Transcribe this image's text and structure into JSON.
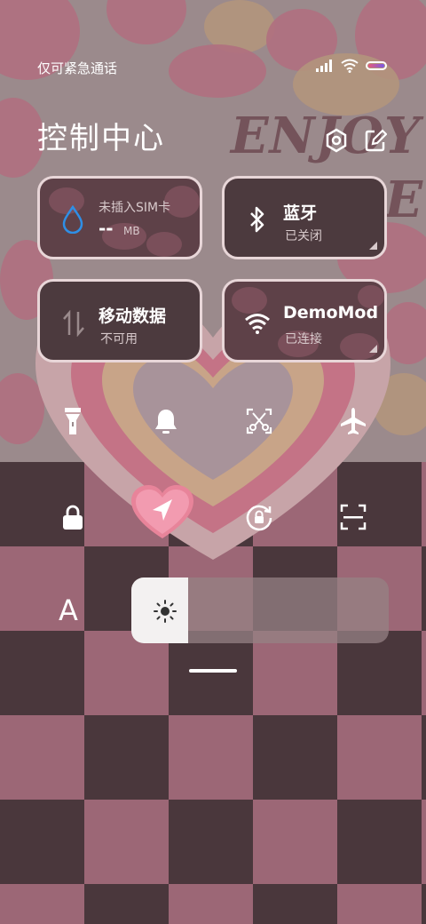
{
  "status": {
    "carrier_text": "仅可紧急通话",
    "icons": [
      "signal-icon",
      "wifi-icon",
      "battery-icon"
    ]
  },
  "header": {
    "title": "控制中心",
    "icons": [
      "settings-icon",
      "edit-icon"
    ]
  },
  "background": {
    "decor_text_1": "ENJOY",
    "decor_text_2": "E"
  },
  "tiles": [
    {
      "id": "sim",
      "main": "--",
      "unit": "MB",
      "sub": "未插入SIM卡",
      "icon": "water-drop-icon"
    },
    {
      "id": "bluetooth",
      "main": "蓝牙",
      "sub": "已关闭",
      "icon": "bluetooth-icon"
    },
    {
      "id": "mobile-data",
      "main": "移动数据",
      "sub": "不可用",
      "icon": "data-arrows-icon"
    },
    {
      "id": "wifi",
      "main": "DemoMod",
      "sub": "已连接",
      "icon": "wifi-icon"
    }
  ],
  "toggles_row1": [
    "flashlight-icon",
    "bell-icon",
    "screenshot-icon",
    "airplane-icon"
  ],
  "toggles_row2": [
    "lock-icon",
    "location-icon",
    "rotation-lock-icon",
    "scanner-icon"
  ],
  "brightness": {
    "label": "A",
    "level": 0.22
  },
  "colors": {
    "accent_blue": "#2f8fe6",
    "tile_dark": "#4c3a3e",
    "tile_border": "#e8d6d8",
    "heart_pink": "#e8849a"
  }
}
